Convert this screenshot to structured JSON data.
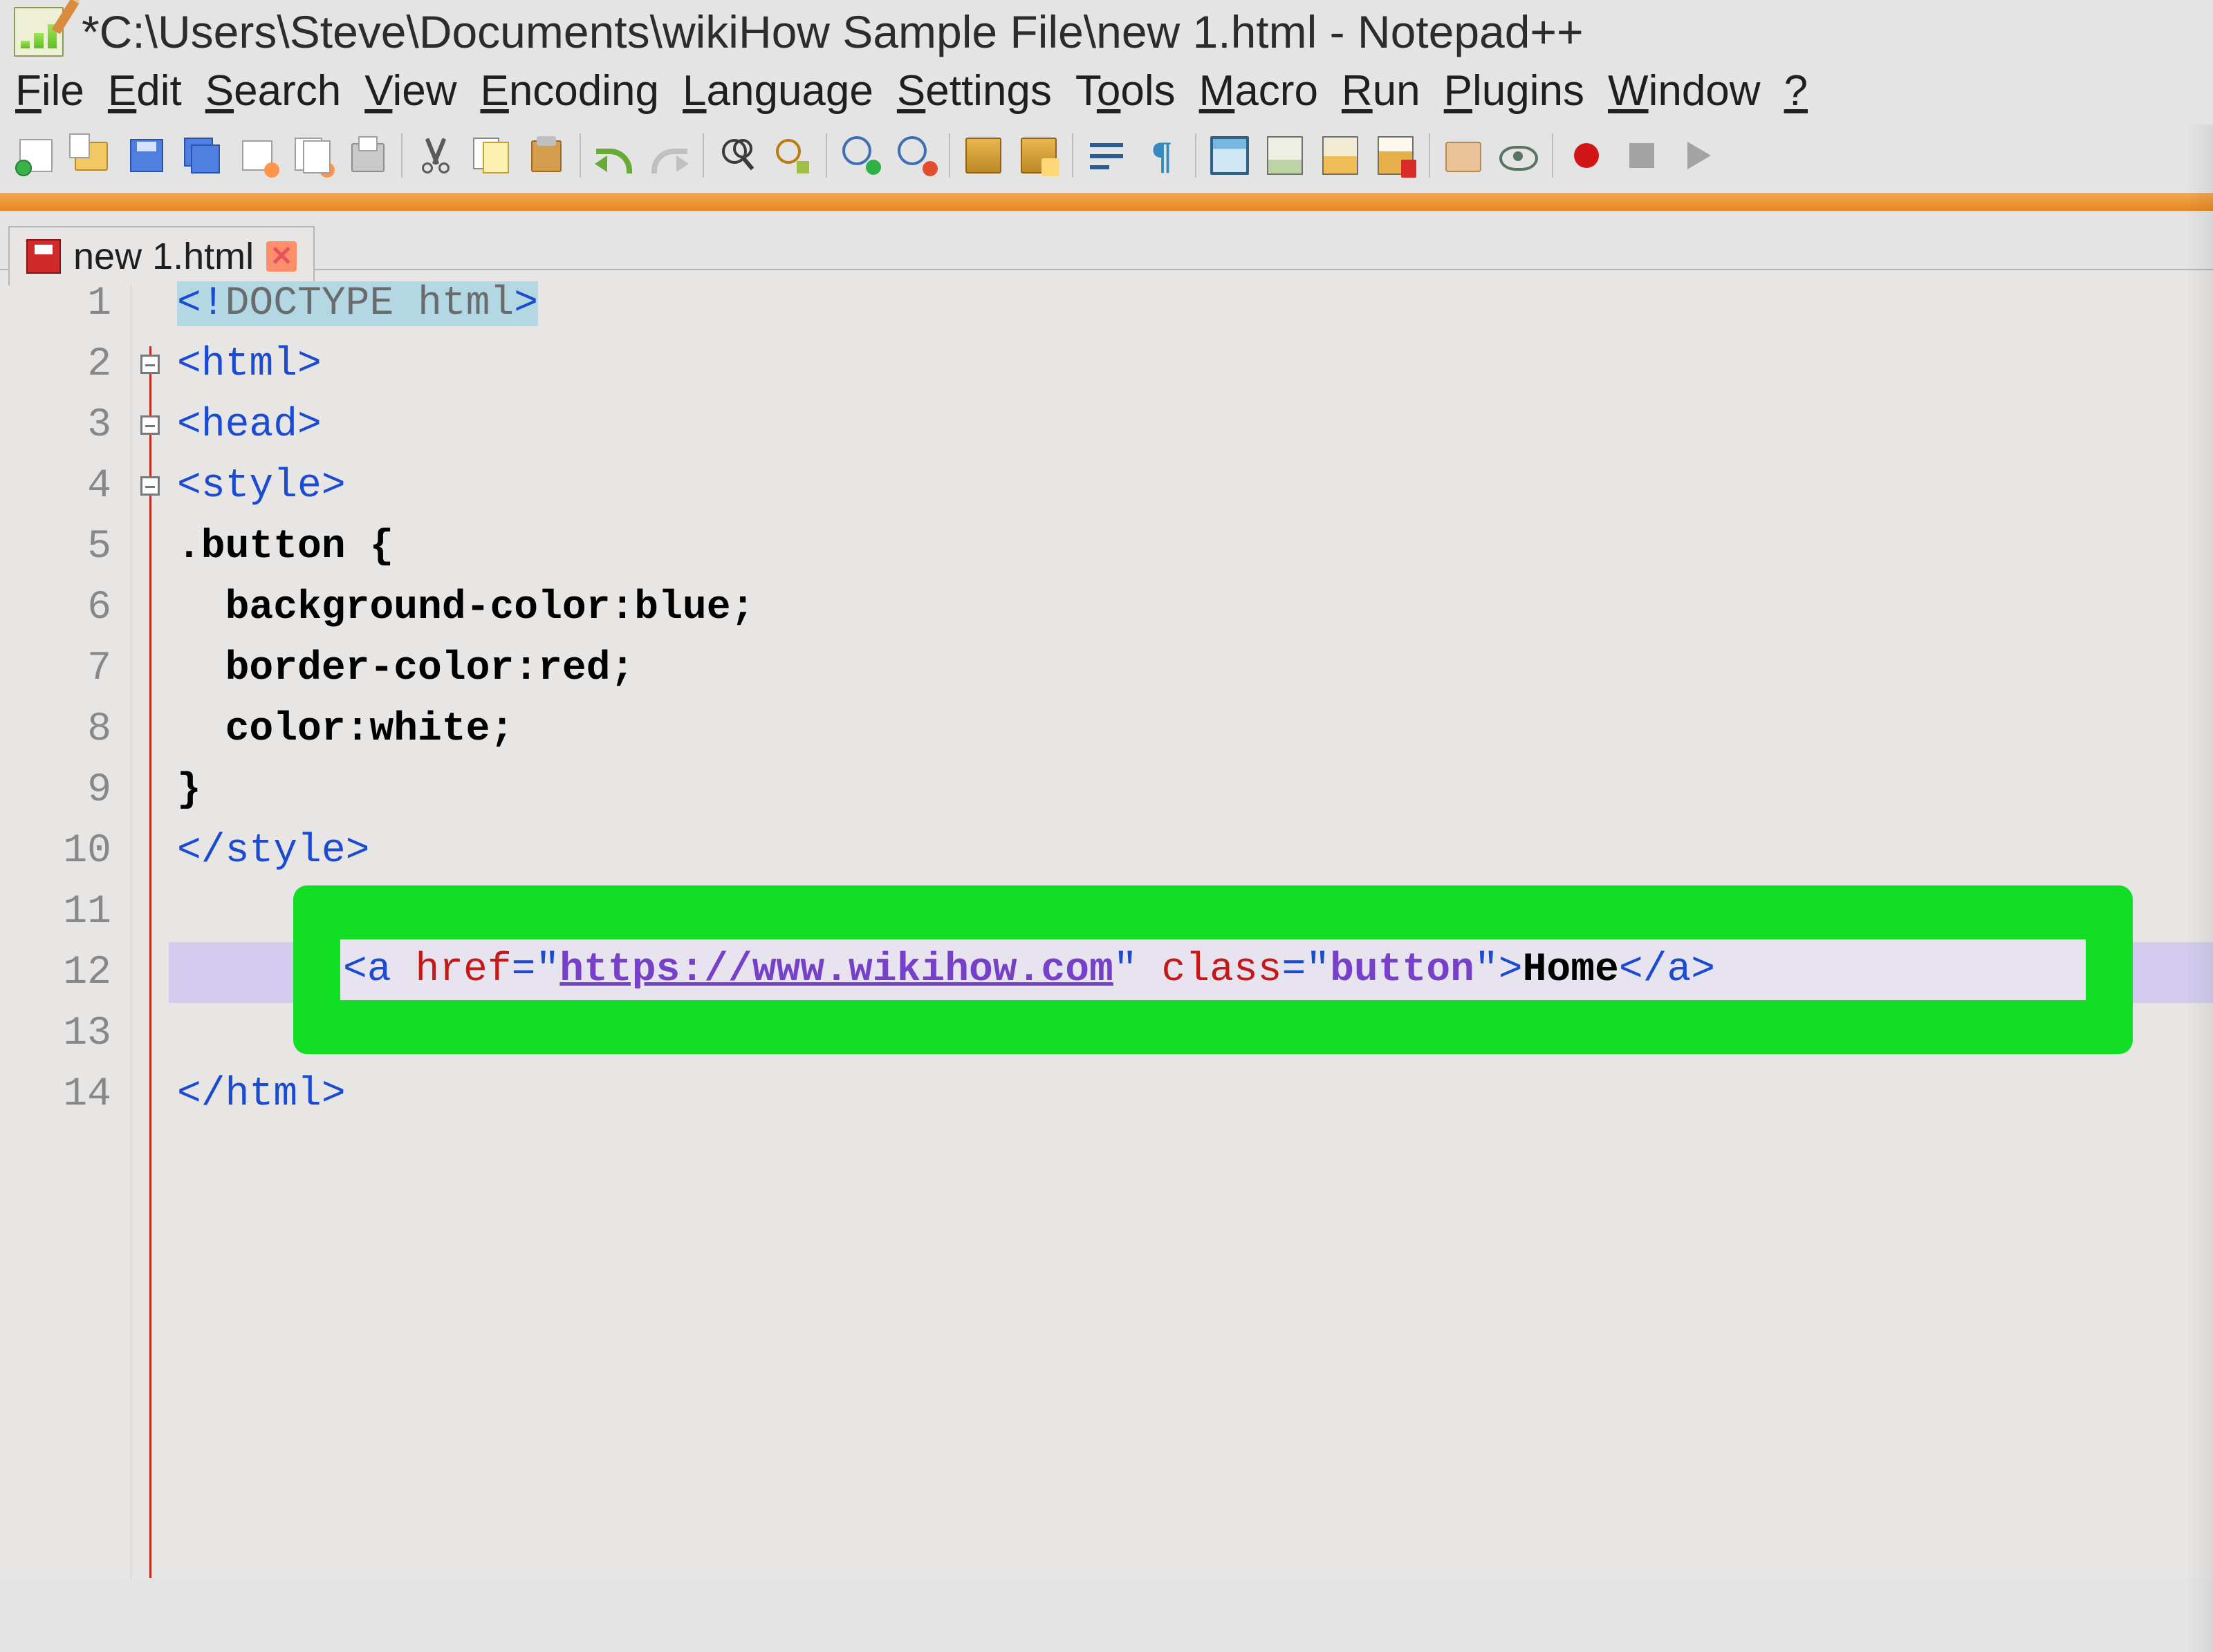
{
  "titlebar": {
    "title": "*C:\\Users\\Steve\\Documents\\wikiHow Sample File\\new 1.html - Notepad++"
  },
  "menu": {
    "items": [
      {
        "label": "File",
        "u": "F"
      },
      {
        "label": "Edit",
        "u": "E"
      },
      {
        "label": "Search",
        "u": "S"
      },
      {
        "label": "View",
        "u": "V"
      },
      {
        "label": "Encoding",
        "u": "E"
      },
      {
        "label": "Language",
        "u": "L"
      },
      {
        "label": "Settings",
        "u": "S"
      },
      {
        "label": "Tools",
        "u": "T"
      },
      {
        "label": "Macro",
        "u": "M"
      },
      {
        "label": "Run",
        "u": "R"
      },
      {
        "label": "Plugins",
        "u": "P"
      },
      {
        "label": "Window",
        "u": "W"
      },
      {
        "label": "?",
        "u": ""
      }
    ]
  },
  "toolbar_icons": [
    "new",
    "open",
    "save",
    "saveall",
    "close",
    "closeall",
    "print",
    "|",
    "cut",
    "copy",
    "paste",
    "|",
    "undo",
    "redo",
    "|",
    "find",
    "replace",
    "|",
    "zoomin",
    "zoomout",
    "|",
    "sync",
    "sync2",
    "|",
    "wrap",
    "pilcrow",
    "|",
    "indent",
    "doc",
    "doc2",
    "doc3",
    "|",
    "folder",
    "eye",
    "|",
    "rec",
    "stop",
    "play"
  ],
  "tab": {
    "name": "new 1.html"
  },
  "code": {
    "line_numbers": [
      "1",
      "2",
      "3",
      "4",
      "5",
      "6",
      "7",
      "8",
      "9",
      "10",
      "11",
      "12",
      "13",
      "14"
    ],
    "l1_a": "<!",
    "l1_b": "DOCTYPE html",
    "l1_c": ">",
    "l2_a": "<",
    "l2_b": "html",
    "l2_c": ">",
    "l3_a": "<",
    "l3_b": "head",
    "l3_c": ">",
    "l4_a": "<",
    "l4_b": "style",
    "l4_c": ">",
    "l5": ".button {",
    "l6": "  background-color:blue;",
    "l7": "  border-color:red;",
    "l8": "  color:white;",
    "l9": "}",
    "l10_a": "</",
    "l10_b": "style",
    "l10_c": ">",
    "l12": {
      "open": "<",
      "tag": "a",
      "sp": " ",
      "attr1": "href",
      "eq": "=",
      "q": "\"",
      "url": "https://www.wikihow.com",
      "q2": "\"",
      "sp2": " ",
      "attr2": "class",
      "eq2": "=",
      "q3": "\"",
      "cls": "button",
      "q4": "\"",
      "close": ">",
      "text": "Home",
      "end_open": "</",
      "end_tag": "a",
      "end_close": ">"
    },
    "l14_a": "</",
    "l14_b": "html",
    "l14_c": ">"
  }
}
